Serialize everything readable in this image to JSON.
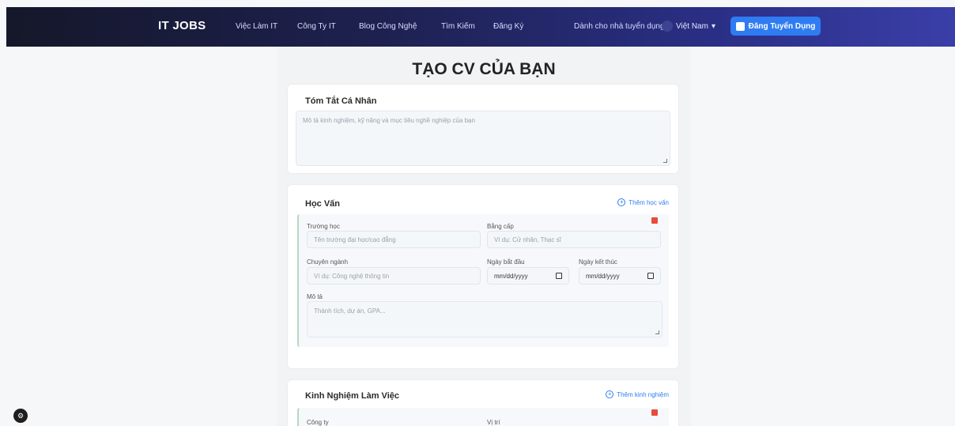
{
  "nav": {
    "logo": "IT JOBS",
    "items": [
      "Việc Làm IT",
      "Công Ty IT",
      "Blog Công Nghệ",
      "Tìm Kiếm",
      "Đăng Ký"
    ],
    "employer_link": "Dành cho nhà tuyển dụng",
    "language": "Việt Nam",
    "post_button": "Đăng Tuyển Dụng"
  },
  "page": {
    "title": "TẠO CV CỦA BẠN"
  },
  "summary": {
    "title": "Tóm Tắt Cá Nhân",
    "placeholder": "Mô tả kinh nghiệm, kỹ năng và mục tiêu nghề nghiệp của bạn"
  },
  "education": {
    "title": "Học Vấn",
    "add_label": "Thêm học vấn",
    "school_label": "Trường học",
    "school_placeholder": "Tên trường đại học/cao đẳng",
    "degree_label": "Bằng cấp",
    "degree_placeholder": "Ví dụ: Cử nhân, Thạc sĩ",
    "major_label": "Chuyên ngành",
    "major_placeholder": "Ví dụ: Công nghệ thông tin",
    "start_label": "Ngày bắt đầu",
    "start_value": "mm/dd/yyyy",
    "end_label": "Ngày kết thúc",
    "end_value": "mm/dd/yyyy",
    "desc_label": "Mô tả",
    "desc_placeholder": "Thành tích, dự án, GPA..."
  },
  "experience": {
    "title": "Kinh Nghiệm Làm Việc",
    "add_label": "Thêm kinh nghiệm",
    "company_label": "Công ty",
    "position_label": "Vị trí"
  },
  "colors": {
    "accent": "#2f7cf2",
    "delete": "#e74c3c"
  }
}
